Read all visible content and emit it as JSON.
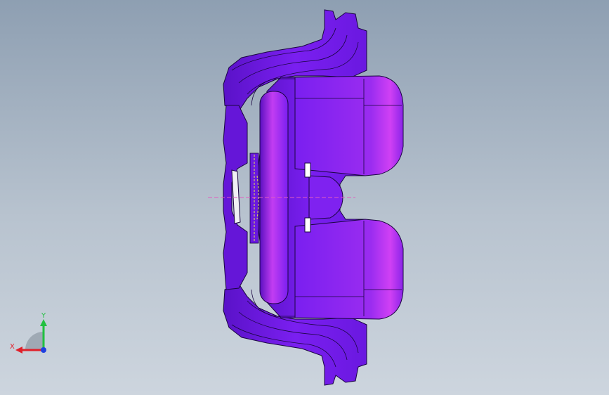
{
  "viewport": {
    "background_top": "#8e9fb2",
    "background_bottom": "#cdd5de"
  },
  "model": {
    "body_color": "#7a1ff0",
    "shade_color": "#5510b8",
    "highlight_color": "#c13cf2",
    "edge_color": "#1a0640",
    "centerline_color": "#e05cc0",
    "feature_color": "#e8e84a"
  },
  "triad": {
    "x_label": "X",
    "y_label": "Y",
    "x_color": "#e0202a",
    "y_color": "#22c040",
    "z_color": "#2040e0"
  }
}
